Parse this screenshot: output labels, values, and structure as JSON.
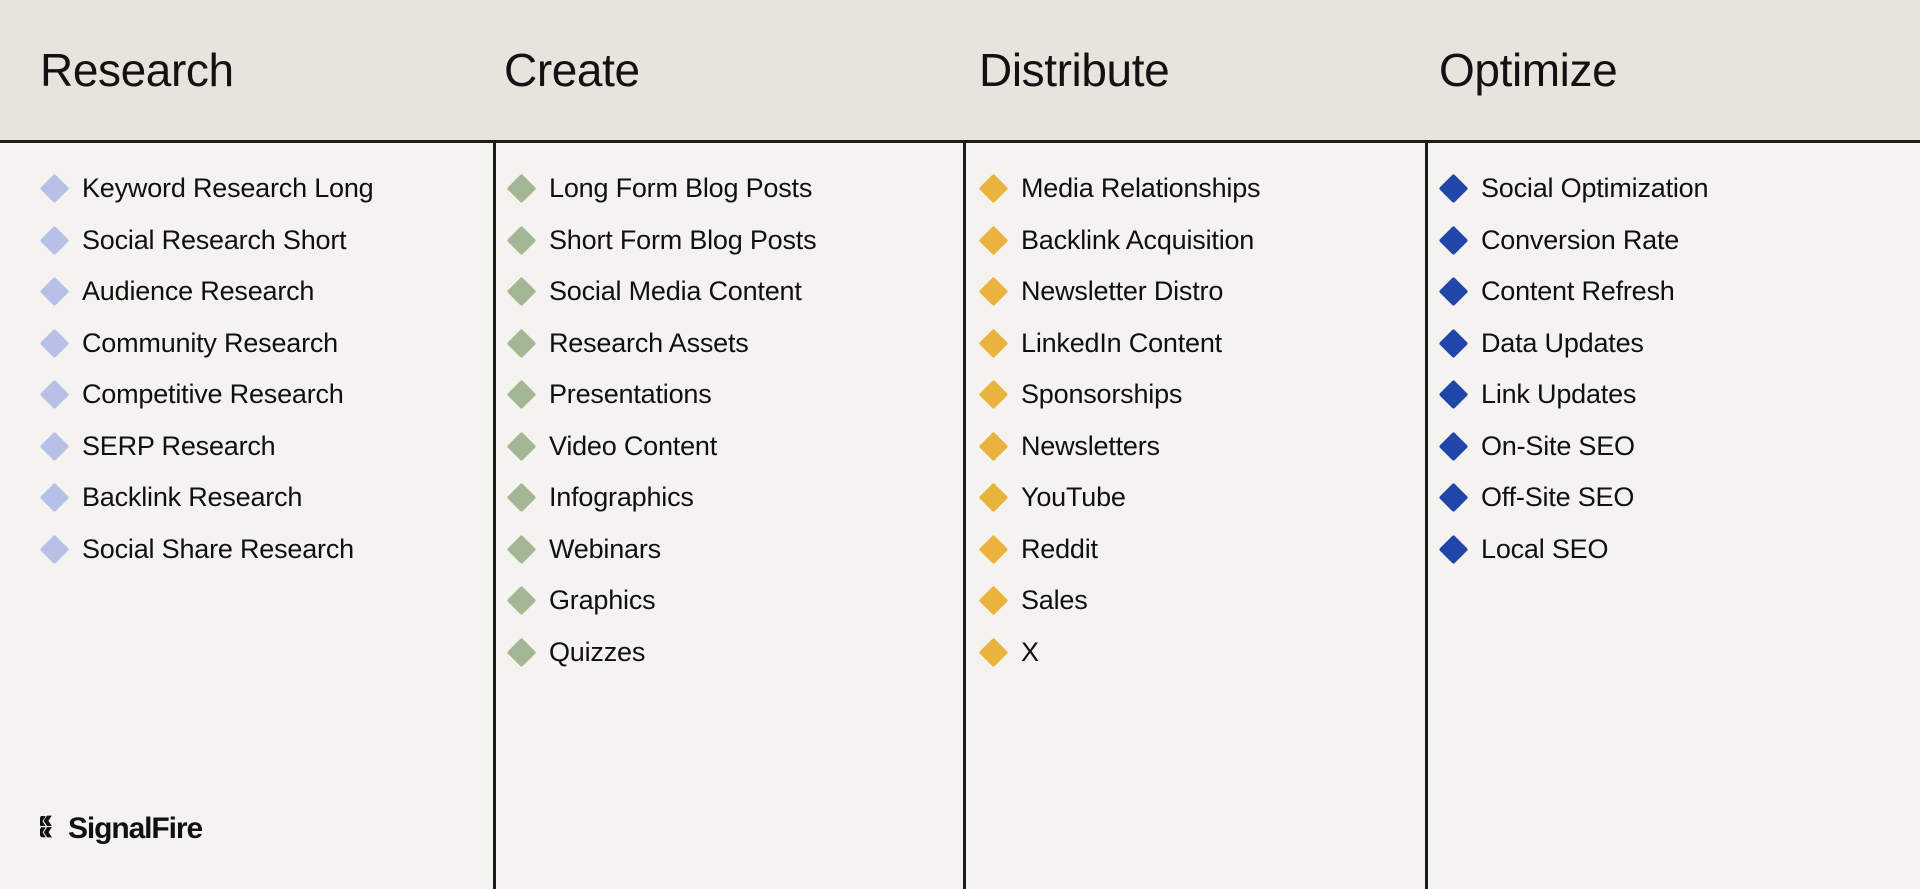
{
  "theme": {
    "header_background": "#e7e4dd",
    "body_background": "#f4f3ef",
    "rule_color": "#1c1c1c",
    "text_color": "#101010"
  },
  "columns": [
    {
      "title": "Research",
      "accent": "#b7c0e6",
      "items": [
        "Keyword Research Long",
        "Social Research Short",
        "Audience Research",
        "Community Research",
        "Competitive Research",
        "SERP Research",
        "Backlink Research",
        "Social Share Research"
      ]
    },
    {
      "title": "Create",
      "accent": "#a4b794",
      "items": [
        "Long Form Blog Posts",
        "Short Form Blog Posts",
        "Social Media Content",
        "Research Assets",
        "Presentations",
        "Video Content",
        "Infographics",
        "Webinars",
        "Graphics",
        "Quizzes"
      ]
    },
    {
      "title": "Distribute",
      "accent": "#eab33e",
      "items": [
        "Media Relationships",
        "Backlink Acquisition",
        "Newsletter Distro",
        "LinkedIn Content",
        "Sponsorships",
        "Newsletters",
        "YouTube",
        "Reddit",
        "Sales",
        "X"
      ]
    },
    {
      "title": "Optimize",
      "accent": "#1f46a8",
      "items": [
        "Social Optimization",
        "Conversion Rate",
        "Content Refresh",
        "Data Updates",
        "Link Updates",
        "On-Site SEO",
        "Off-Site SEO",
        "Local SEO"
      ]
    }
  ],
  "logo": {
    "wordmark": "SignalFire",
    "mark": "signalfire-mark-icon"
  }
}
